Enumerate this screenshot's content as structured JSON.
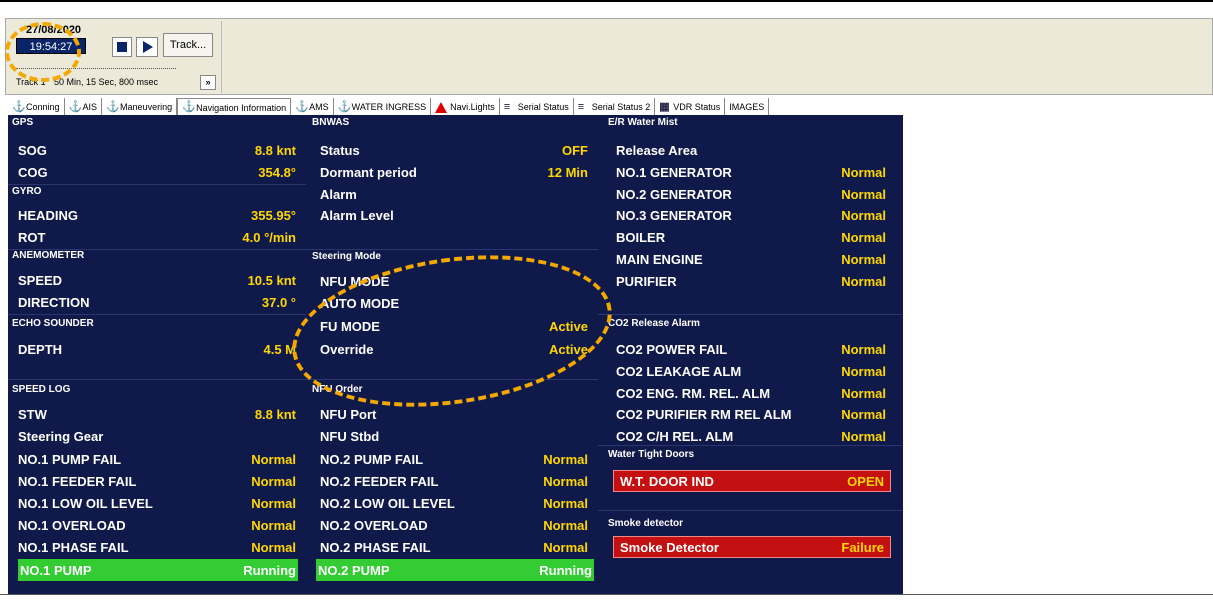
{
  "player": {
    "date": "27/08/2020",
    "time": "19:54:27",
    "track_button": "Track...",
    "track_label": "Track 1",
    "duration": "50 Min, 15 Sec, 800 msec",
    "more_button": "»"
  },
  "tabs": [
    {
      "label": "Conning"
    },
    {
      "label": "AIS"
    },
    {
      "label": "Maneuvering"
    },
    {
      "label": "Navigation Information"
    },
    {
      "label": "AMS"
    },
    {
      "label": "WATER INGRESS"
    },
    {
      "label": "Navi.Lights"
    },
    {
      "label": "Serial Status"
    },
    {
      "label": "Serial Status 2"
    },
    {
      "label": "VDR Status"
    },
    {
      "label": "IMAGES"
    }
  ],
  "col1": {
    "gps": "GPS",
    "sog": {
      "label": "SOG",
      "value": "8.8 knt"
    },
    "cog": {
      "label": "COG",
      "value": "354.8°"
    },
    "gyro": "GYRO",
    "heading": {
      "label": "HEADING",
      "value": "355.95°"
    },
    "rot": {
      "label": "ROT",
      "value": "4.0 °/min"
    },
    "anemometer": "ANEMOMETER",
    "speed": {
      "label": "SPEED",
      "value": "10.5  knt"
    },
    "direction": {
      "label": "DIRECTION",
      "value": "37.0 °"
    },
    "echo": "ECHO SOUNDER",
    "depth": {
      "label": "DEPTH",
      "value": "4.5 M"
    },
    "speedlog": "SPEED LOG",
    "stw": {
      "label": "STW",
      "value": "8.8 knt"
    },
    "steering": "Steering Gear",
    "r1": {
      "label": "NO.1 PUMP FAIL",
      "value": "Normal"
    },
    "r2": {
      "label": "NO.1 FEEDER FAIL",
      "value": "Normal"
    },
    "r3": {
      "label": "NO.1 LOW OIL LEVEL",
      "value": "Normal"
    },
    "r4": {
      "label": "NO.1 OVERLOAD",
      "value": "Normal"
    },
    "r5": {
      "label": "NO.1 PHASE FAIL",
      "value": "Normal"
    },
    "r6": {
      "label": "NO.1 PUMP",
      "value": "Running"
    }
  },
  "col2": {
    "bnwas": "BNWAS",
    "status": {
      "label": "Status",
      "value": "OFF"
    },
    "dormant": {
      "label": "Dormant period",
      "value": "12 Min"
    },
    "alarm": {
      "label": "Alarm",
      "value": ""
    },
    "alarm_level": {
      "label": "Alarm Level",
      "value": ""
    },
    "steering_mode": "Steering Mode",
    "nfu_mode": {
      "label": "NFU MODE",
      "value": ""
    },
    "auto_mode": {
      "label": "AUTO MODE",
      "value": ""
    },
    "fu_mode": {
      "label": "FU MODE",
      "value": "Active"
    },
    "override": {
      "label": "Override",
      "value": "Active"
    },
    "nfu_order": "NFU Order",
    "nfu_port": {
      "label": "NFU Port",
      "value": ""
    },
    "nfu_stbd": {
      "label": "NFU Stbd",
      "value": ""
    },
    "r1": {
      "label": "NO.2 PUMP FAIL",
      "value": "Normal"
    },
    "r2": {
      "label": "NO.2 FEEDER FAIL",
      "value": "Normal"
    },
    "r3": {
      "label": "NO.2 LOW OIL LEVEL",
      "value": "Normal"
    },
    "r4": {
      "label": "NO.2 OVERLOAD",
      "value": "Normal"
    },
    "r5": {
      "label": "NO.2 PHASE FAIL",
      "value": "Normal"
    },
    "r6": {
      "label": "NO.2 PUMP",
      "value": "Running"
    }
  },
  "col3": {
    "er": "E/R Water Mist",
    "release_area": {
      "label": "Release Area",
      "value": ""
    },
    "g1": {
      "label": "NO.1 GENERATOR",
      "value": "Normal"
    },
    "g2": {
      "label": "NO.2 GENERATOR",
      "value": "Normal"
    },
    "g3": {
      "label": "NO.3 GENERATOR",
      "value": "Normal"
    },
    "boiler": {
      "label": "BOILER",
      "value": "Normal"
    },
    "main_engine": {
      "label": "MAIN ENGINE",
      "value": "Normal"
    },
    "purifier": {
      "label": "PURIFIER",
      "value": "Normal"
    },
    "co2": "CO2 Release Alarm",
    "c1": {
      "label": "CO2 POWER FAIL",
      "value": "Normal"
    },
    "c2": {
      "label": "CO2 LEAKAGE ALM",
      "value": "Normal"
    },
    "c3": {
      "label": "CO2 ENG. RM. REL. ALM",
      "value": "Normal"
    },
    "c4": {
      "label": "CO2 PURIFIER RM REL ALM",
      "value": "Normal"
    },
    "c5": {
      "label": "CO2 C/H REL. ALM",
      "value": "Normal"
    },
    "wtd": "Water Tight Doors",
    "wt_door": {
      "label": "W.T. DOOR IND",
      "value": "OPEN"
    },
    "smoke": "Smoke detector",
    "smoke_det": {
      "label": "Smoke Detector",
      "value": "Failure"
    }
  },
  "colors": {
    "panel_bg": "#101a4a",
    "value_yellow": "#ffd700",
    "running_green": "#33cc33",
    "alarm_red": "#c41010",
    "highlight_ring": "#f5a800"
  }
}
